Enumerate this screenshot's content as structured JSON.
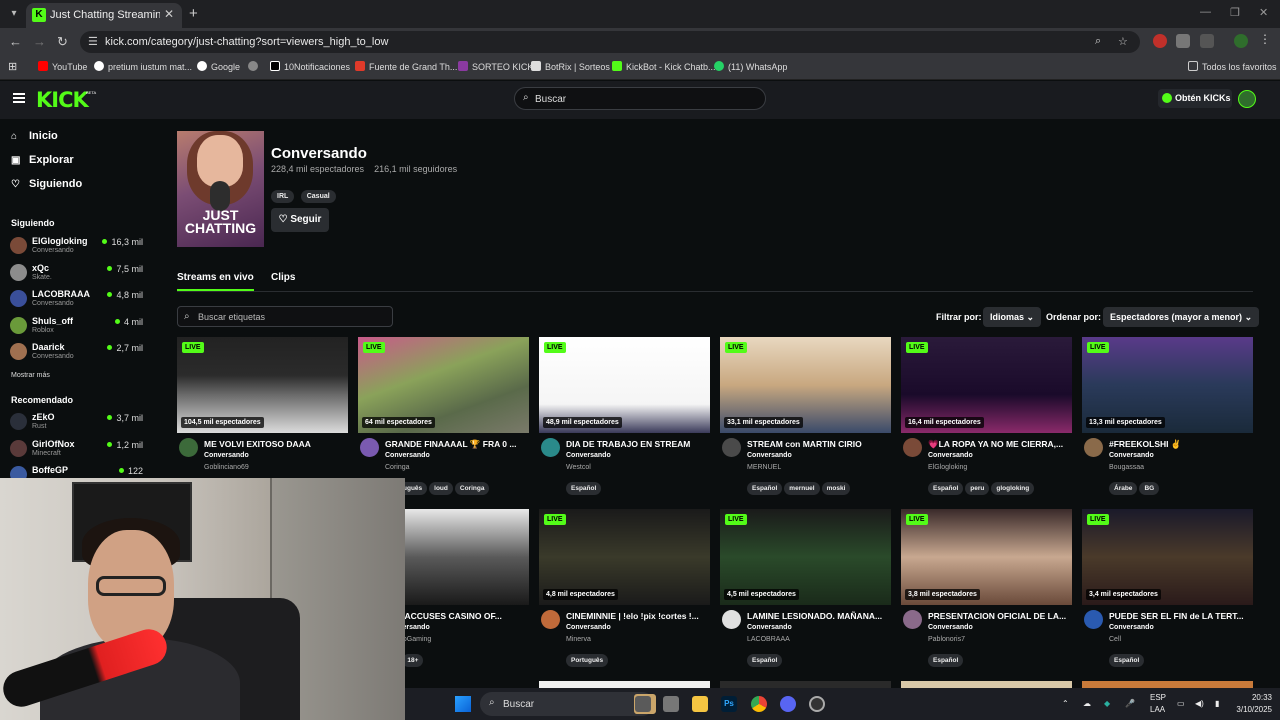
{
  "browser": {
    "tab_title": "Just Chatting Streaming - Live S",
    "url": "kick.com/category/just-chatting?sort=viewers_high_to_low",
    "bookmarks": [
      "YouTube",
      "pretium iustum mat...",
      "Google",
      "10Notificaciones",
      "Fuente de Grand Th...",
      "SORTEO KICK",
      "BotRix | Sorteos",
      "KickBot - Kick Chatb...",
      "(11) WhatsApp",
      "Todos los favoritos"
    ]
  },
  "header": {
    "logo": "KICK",
    "logo_badge": "BETA",
    "search_placeholder": "Buscar",
    "kicks_button": "Obtén KICKs"
  },
  "sidebar": {
    "nav": [
      {
        "label": "Inicio",
        "icon": "home-icon"
      },
      {
        "label": "Explorar",
        "icon": "compass-icon"
      },
      {
        "label": "Siguiendo",
        "icon": "heart-icon"
      }
    ],
    "following_title": "Siguiendo",
    "following": [
      {
        "name": "ElGlogloking",
        "category": "Conversando",
        "viewers": "16,3 mil",
        "color": "#7a4a38"
      },
      {
        "name": "xQc",
        "category": "Skate.",
        "viewers": "7,5 mil",
        "color": "#8c8c8c"
      },
      {
        "name": "LACOBRAAA",
        "category": "Conversando",
        "viewers": "4,8 mil",
        "color": "#3a4f9a"
      },
      {
        "name": "Shuls_off",
        "category": "Roblox",
        "viewers": "4 mil",
        "color": "#6a9a3a"
      },
      {
        "name": "Daarick",
        "category": "Conversando",
        "viewers": "2,7 mil",
        "color": "#a07050"
      }
    ],
    "show_more": "Mostrar más",
    "recommended_title": "Recomendado",
    "recommended": [
      {
        "name": "zEkO",
        "category": "Rust",
        "viewers": "3,7 mil",
        "color": "#2a2f3a"
      },
      {
        "name": "GirlOfNox",
        "category": "Minecraft",
        "viewers": "1,2 mil",
        "color": "#5a3a3a"
      },
      {
        "name": "BoffeGP",
        "category": "",
        "viewers": "122",
        "color": "#3a5aa0"
      }
    ]
  },
  "category": {
    "title": "Conversando",
    "viewers": "228,4 mil espectadores",
    "followers": "216,1 mil seguidores",
    "tags": [
      "IRL",
      "Casual"
    ],
    "follow_label": "Seguir",
    "cover_text_1": "JUST",
    "cover_text_2": "CHATTING"
  },
  "tabs": [
    "Streams en vivo",
    "Clips"
  ],
  "filters": {
    "tag_search_placeholder": "Buscar etiquetas",
    "filter_label": "Filtrar por:",
    "filter_value": "Idiomas",
    "sort_label": "Ordenar por:",
    "sort_value": "Espectadores (mayor a menor)"
  },
  "live_badge": "LIVE",
  "streams": [
    {
      "viewers": "104,5 mil espectadores",
      "title": "ME VOLVI EXITOSO DAAA",
      "category": "Conversando",
      "streamer": "Goblinciano69",
      "tags": [],
      "thumb": "linear-gradient(180deg,#222 0%,#2b2b2b 40%,#6a6a6a 60%,#dcdcdc 100%)",
      "avatar": "#3c6a3a"
    },
    {
      "viewers": "64 mil espectadores",
      "title": "GRANDE FINAAAAL 🏆 FRA 0 ...",
      "category": "Conversando",
      "streamer": "Coringa",
      "tags": [
        "Português",
        "loud",
        "Coringa"
      ],
      "thumb": "linear-gradient(160deg,#c85a8a 0%,#8aa25a 40%,#5a6a4a 70%,#7a7a6a 100%)",
      "avatar": "#7a5ab0"
    },
    {
      "viewers": "48,9 mil espectadores",
      "title": "DIA DE TRABAJO EN STREAM",
      "category": "Conversando",
      "streamer": "Westcol",
      "tags": [
        "Español"
      ],
      "thumb": "linear-gradient(180deg,#ffffff 0%,#f5f5f5 70%,#3a3a5a 100%)",
      "avatar": "#2a8a8a"
    },
    {
      "viewers": "33,1 mil espectadores",
      "title": "STREAM con MARTIN CIRIO",
      "category": "Conversando",
      "streamer": "MERNUEL",
      "tags": [
        "Español",
        "mernuel",
        "moski"
      ],
      "thumb": "linear-gradient(180deg,#e8d8c0 0%,#c8a880 50%,#3a4a6a 100%)",
      "avatar": "#4a4a4a"
    },
    {
      "viewers": "16,4 mil espectadores",
      "title": "💗LA ROPA YA NO ME CIERRA,...",
      "category": "Conversando",
      "streamer": "ElGlogloking",
      "tags": [
        "Español",
        "peru",
        "glogloking"
      ],
      "thumb": "linear-gradient(180deg,#2a1a3a 0%,#1a0a2a 60%,#8a2a6a 100%)",
      "avatar": "#7a4a38"
    },
    {
      "viewers": "13,3 mil espectadores",
      "title": "#FREEKOLSHI ✌",
      "category": "Conversando",
      "streamer": "Bougassaa",
      "tags": [
        "Árabe",
        "BG"
      ],
      "thumb": "linear-gradient(180deg,#5a3a8a 0%,#2a3a5a 50%,#1a2a3a 100%)",
      "avatar": "#8a6a4a"
    },
    {
      "viewers": "...",
      "title": "BBZ ACCUSES CASINO OF...",
      "category": "Conversando",
      "streamer": "CasinoGaming",
      "tags": [
        "...",
        "18+"
      ],
      "thumb": "linear-gradient(180deg,#e8e8e8 0%,#5a5a5a 50%,#1a1a1a 100%)",
      "avatar": "#222222"
    },
    {
      "viewers": "4,8 mil espectadores",
      "title": "CINEMINNIE | !elo !pix !cortes !...",
      "category": "Conversando",
      "streamer": "Minerva",
      "tags": [
        "Português"
      ],
      "thumb": "linear-gradient(180deg,#1a1a1a 0%,#3a3a2a 50%,#1a1a1a 100%)",
      "avatar": "#c06a3a"
    },
    {
      "viewers": "4,5 mil espectadores",
      "title": "LAMINE LESIONADO. MAÑANA...",
      "category": "Conversando",
      "streamer": "LACOBRAAA",
      "tags": [
        "Español"
      ],
      "thumb": "linear-gradient(180deg,#1a1a1a 0%,#2a4a2a 50%,#1a2a1a 100%)",
      "avatar": "#e0e0e0"
    },
    {
      "viewers": "3,8 mil espectadores",
      "title": "PRESENTACION OFICIAL DE LA...",
      "category": "Conversando",
      "streamer": "Pablonoris7",
      "tags": [
        "Español"
      ],
      "thumb": "linear-gradient(180deg,#3a2a2a 0%,#c8a890 50%,#6a4a3a 100%)",
      "avatar": "#8a6a8a"
    },
    {
      "viewers": "3,4 mil espectadores",
      "title": "PUEDE SER EL FIN de LA TERT...",
      "category": "Conversando",
      "streamer": "Cell",
      "tags": [
        "Español"
      ],
      "thumb": "linear-gradient(180deg,#1a1a2a 0%,#4a3a2a 50%,#2a1a1a 100%)",
      "avatar": "#2a5ab0"
    }
  ],
  "taskbar": {
    "search_placeholder": "Buscar",
    "lang_1": "ESP",
    "lang_2": "LAA",
    "time": "20:33",
    "date": "3/10/2025"
  }
}
